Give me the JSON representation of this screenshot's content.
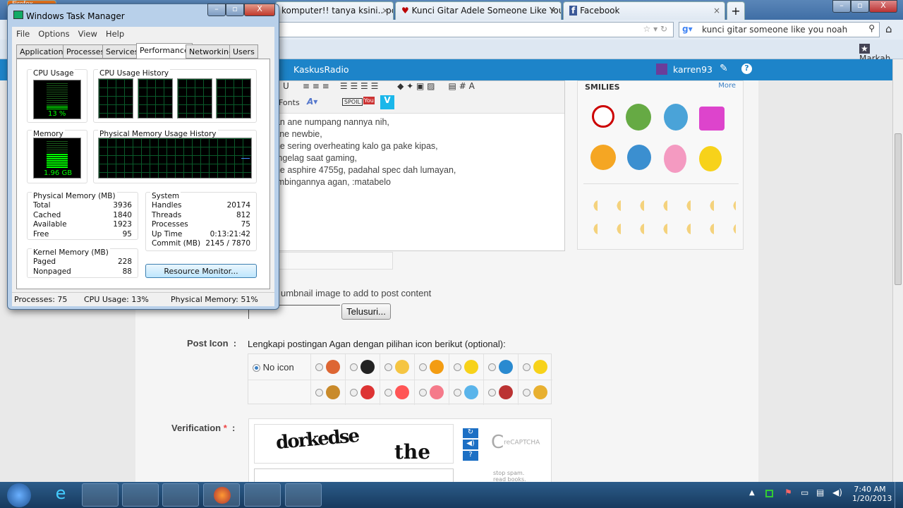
{
  "browser": {
    "tabs": [
      {
        "label": "Firefox"
      },
      {
        "label": "komputer!! tanya ksini.. pc c..."
      },
      {
        "label": "Kunci Gitar Adele Someone Like You ..."
      },
      {
        "label": "Facebook"
      }
    ],
    "new_tab": "+",
    "search_value": "kunci gitar someone like you noah",
    "bookmarks_label": "Markah"
  },
  "kaskus": {
    "nav_item": "KaskusRadio",
    "username": "karren93"
  },
  "editor": {
    "fonts_label": "Fonts",
    "lines": [
      "gan ane numpang nannya nih,",
      "l ane newbie,",
      "ane sering overheating kalo ga pake kipas,",
      "a ngelag saat gaming,",
      "ane asphire 4755g, padahal spec dah lumayan,",
      "bimbingannya agan, :matabelo"
    ]
  },
  "smilies": {
    "title": "SMILIES",
    "more": "More"
  },
  "form": {
    "thumbnail_text": "umbnail image to add to post content",
    "browse_button": "Telusuri...",
    "post_icon_label": "Post Icon",
    "colon": ":",
    "post_icon_desc": "Lengkapi postingan Agan dengan pilihan icon berikut (optional):",
    "no_icon": "No icon",
    "verification_label": "Verification",
    "required_mark": "*",
    "captcha_words": "dorkedse the",
    "captcha_brand": "reCAPTCHA",
    "captcha_tagline": "stop spam. read books."
  },
  "task_manager": {
    "title": "Windows Task Manager",
    "menu": [
      "File",
      "Options",
      "View",
      "Help"
    ],
    "tabs": [
      "Applications",
      "Processes",
      "Services",
      "Performance",
      "Networking",
      "Users"
    ],
    "active_tab": "Performance",
    "cpu_usage_title": "CPU Usage",
    "cpu_usage_value": "13 %",
    "cpu_history_title": "CPU Usage History",
    "memory_title": "Memory",
    "memory_value": "1.96 GB",
    "mem_history_title": "Physical Memory Usage History",
    "physical_memory": {
      "title": "Physical Memory (MB)",
      "rows": [
        [
          "Total",
          "3936"
        ],
        [
          "Cached",
          "1840"
        ],
        [
          "Available",
          "1923"
        ],
        [
          "Free",
          "95"
        ]
      ]
    },
    "kernel_memory": {
      "title": "Kernel Memory (MB)",
      "rows": [
        [
          "Paged",
          "228"
        ],
        [
          "Nonpaged",
          "88"
        ]
      ]
    },
    "system": {
      "title": "System",
      "rows": [
        [
          "Handles",
          "20174"
        ],
        [
          "Threads",
          "812"
        ],
        [
          "Processes",
          "75"
        ],
        [
          "Up Time",
          "0:13:21:42"
        ],
        [
          "Commit (MB)",
          "2145 / 7870"
        ]
      ]
    },
    "resource_monitor_button": "Resource Monitor...",
    "status": {
      "processes": "Processes: 75",
      "cpu": "CPU Usage: 13%",
      "memory": "Physical Memory: 51%"
    },
    "cpu_percent": 13,
    "memory_percent": 51
  },
  "taskbar": {
    "time": "7:40 AM",
    "date": "1/20/2013"
  },
  "colors": {
    "kaskus_blue": "#1d84c9",
    "graph_green": "#00ff00"
  }
}
